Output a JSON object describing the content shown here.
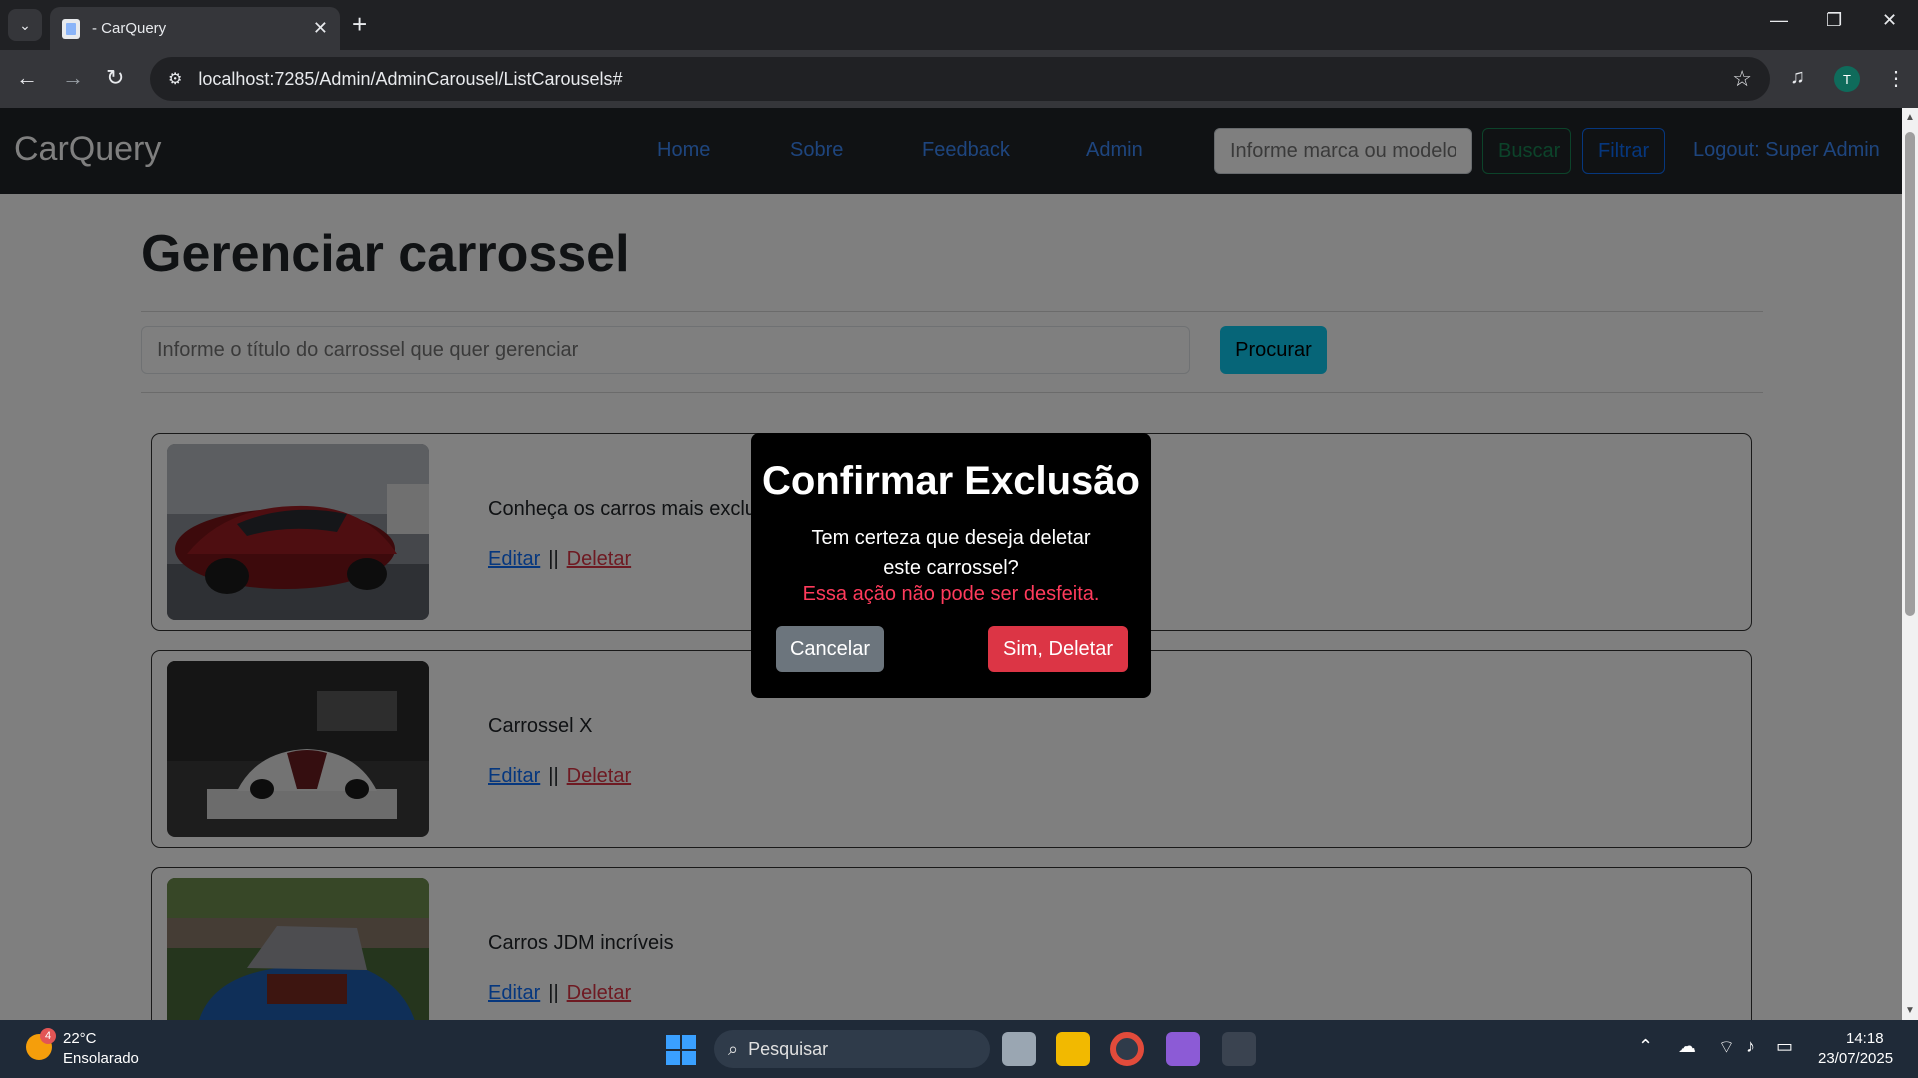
{
  "browser": {
    "tab_title": "- CarQuery",
    "tab_close": "✕",
    "new_tab": "+",
    "url": "localhost:7285/Admin/AdminCarousel/ListCarousels#",
    "profile_initial": "T",
    "icons": [
      "tab-search-icon",
      "back-arrow-icon",
      "forward-arrow-icon",
      "reload-icon",
      "site-settings-icon",
      "bookmark-star-icon",
      "media-control-icon",
      "kebab-menu-icon",
      "minimize-icon",
      "restore-icon",
      "close-window-icon"
    ]
  },
  "navbar": {
    "brand": "CarQuery",
    "links": [
      "Home",
      "Sobre",
      "Feedback",
      "Admin"
    ],
    "search_placeholder": "Informe marca ou modelo",
    "buscar": "Buscar",
    "filtrar": "Filtrar",
    "logout": "Logout: Super Admin"
  },
  "page": {
    "title": "Gerenciar carrossel",
    "search_placeholder": "Informe o título do carrossel que quer gerenciar",
    "search_button": "Procurar",
    "carousels": [
      {
        "title": "Conheça os carros mais exclusivos",
        "edit": "Editar",
        "delete": "Deletar",
        "image": "red-sports-car-photo"
      },
      {
        "title": "Carrossel X",
        "edit": "Editar",
        "delete": "Deletar",
        "image": "white-hypercar-showroom-photo"
      },
      {
        "title": "Carros JDM incríveis",
        "edit": "Editar",
        "delete": "Deletar",
        "image": "blue-jdm-car-photo"
      }
    ],
    "separator": "||"
  },
  "modal": {
    "title": "Confirmar Exclusão",
    "message": "Tem certeza que deseja deletar este carrossel?",
    "warning": "Essa ação não pode ser desfeita.",
    "cancel": "Cancelar",
    "confirm": "Sim, Deletar"
  },
  "taskbar": {
    "weather_badge": "4",
    "temperature": "22°C",
    "condition": "Ensolarado",
    "search_label": "Pesquisar",
    "time": "14:18",
    "date": "23/07/2025"
  },
  "colors": {
    "navbar_bg": "#212529",
    "link_blue": "#3d8bfd",
    "success": "#198754",
    "primary": "#0d6efd",
    "info": "#0dcaf0",
    "danger": "#dc3545",
    "warning_text": "#ff3b5c"
  }
}
